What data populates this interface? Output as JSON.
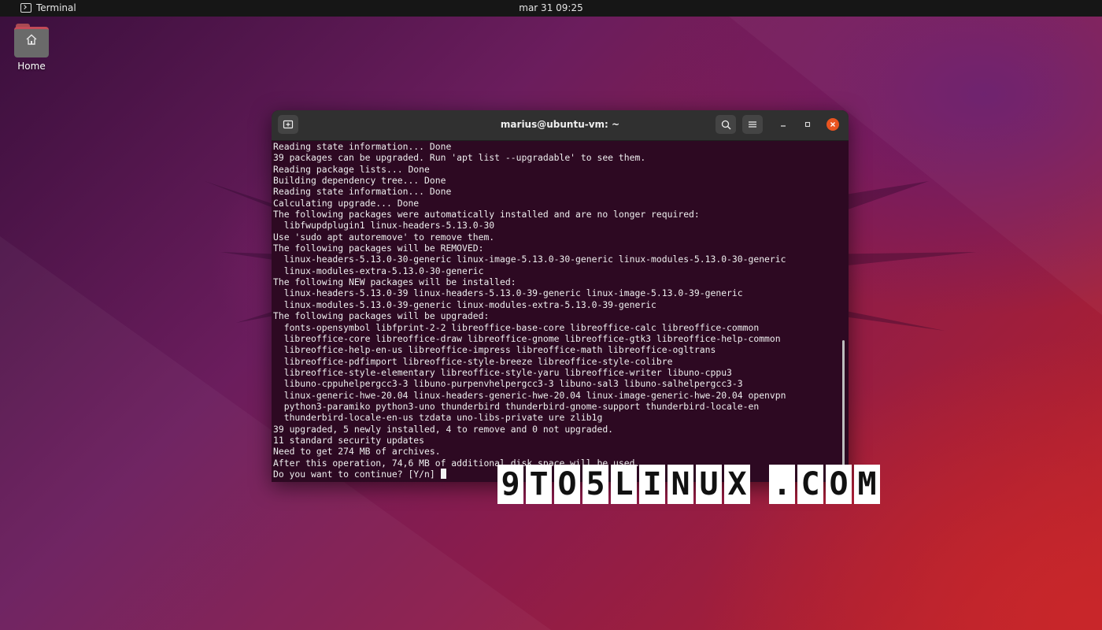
{
  "topbar": {
    "app_name": "Terminal",
    "clock": "mar 31  09:25"
  },
  "desktop": {
    "home_label": "Home"
  },
  "terminal": {
    "title": "marius@ubuntu-vm: ~",
    "lines": [
      "Reading state information... Done",
      "39 packages can be upgraded. Run 'apt list --upgradable' to see them.",
      "Reading package lists... Done",
      "Building dependency tree... Done",
      "Reading state information... Done",
      "Calculating upgrade... Done",
      "The following packages were automatically installed and are no longer required:",
      "  libfwupdplugin1 linux-headers-5.13.0-30",
      "Use 'sudo apt autoremove' to remove them.",
      "The following packages will be REMOVED:",
      "  linux-headers-5.13.0-30-generic linux-image-5.13.0-30-generic linux-modules-5.13.0-30-generic",
      "  linux-modules-extra-5.13.0-30-generic",
      "The following NEW packages will be installed:",
      "  linux-headers-5.13.0-39 linux-headers-5.13.0-39-generic linux-image-5.13.0-39-generic",
      "  linux-modules-5.13.0-39-generic linux-modules-extra-5.13.0-39-generic",
      "The following packages will be upgraded:",
      "  fonts-opensymbol libfprint-2-2 libreoffice-base-core libreoffice-calc libreoffice-common",
      "  libreoffice-core libreoffice-draw libreoffice-gnome libreoffice-gtk3 libreoffice-help-common",
      "  libreoffice-help-en-us libreoffice-impress libreoffice-math libreoffice-ogltrans",
      "  libreoffice-pdfimport libreoffice-style-breeze libreoffice-style-colibre",
      "  libreoffice-style-elementary libreoffice-style-yaru libreoffice-writer libuno-cppu3",
      "  libuno-cppuhelpergcc3-3 libuno-purpenvhelpergcc3-3 libuno-sal3 libuno-salhelpergcc3-3",
      "  linux-generic-hwe-20.04 linux-headers-generic-hwe-20.04 linux-image-generic-hwe-20.04 openvpn",
      "  python3-paramiko python3-uno thunderbird thunderbird-gnome-support thunderbird-locale-en",
      "  thunderbird-locale-en-us tzdata uno-libs-private ure zlib1g",
      "39 upgraded, 5 newly installed, 4 to remove and 0 not upgraded.",
      "11 standard security updates",
      "Need to get 274 MB of archives.",
      "After this operation, 74,6 MB of additional disk space will be used.",
      "Do you want to continue? [Y/n] "
    ]
  },
  "watermark": [
    "9",
    "T",
    "O",
    "5",
    "L",
    "I",
    "N",
    "U",
    "X",
    " ",
    ".",
    "C",
    "O",
    "M"
  ]
}
